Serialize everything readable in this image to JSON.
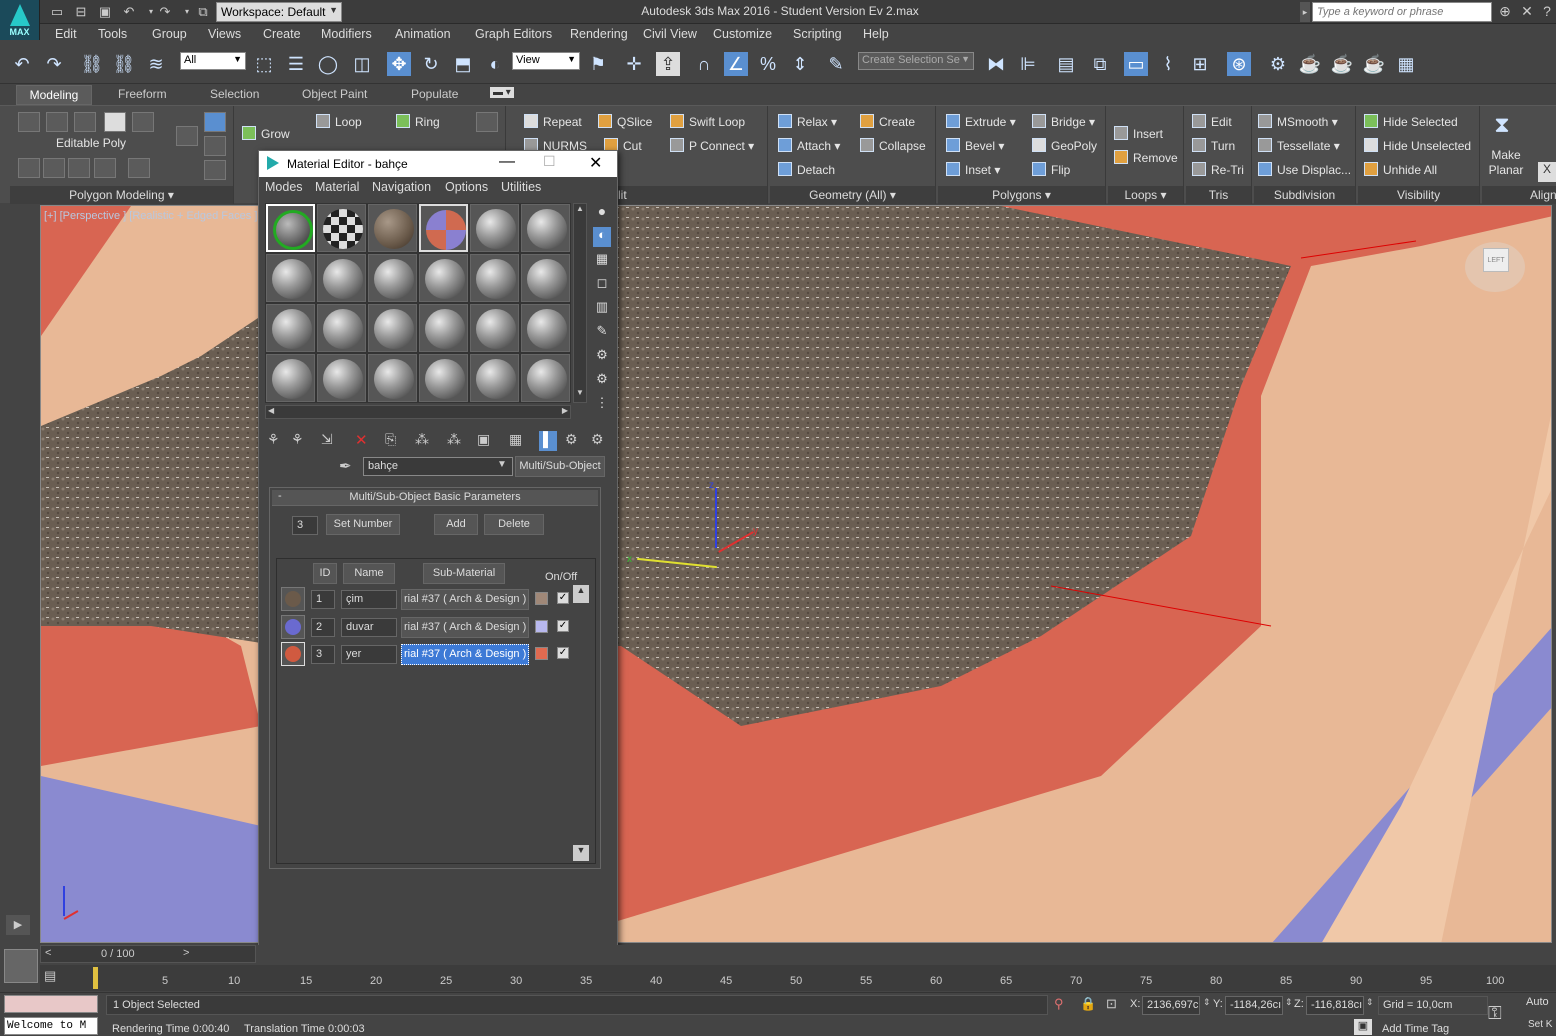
{
  "app": {
    "logo_text": "MAX",
    "window_title": "Autodesk 3ds Max 2016 - Student Version    Ev 2.max",
    "workspace_label": "Workspace: Default",
    "search_placeholder": "Type a keyword or phrase"
  },
  "menu": [
    "Edit",
    "Tools",
    "Group",
    "Views",
    "Create",
    "Modifiers",
    "Animation",
    "Graph Editors",
    "Rendering",
    "Civil View",
    "Customize",
    "Scripting",
    "Help"
  ],
  "toolbar": {
    "selection_filter": "All",
    "ref_coord": "View",
    "named_selection_placeholder": "Create Selection Se"
  },
  "ribbon_tabs": [
    "Modeling",
    "Freeform",
    "Selection",
    "Object Paint",
    "Populate"
  ],
  "ribbon": {
    "polygon_modeling": {
      "object_label": "Editable Poly",
      "footer": "Polygon Modeling"
    },
    "modify_selection": {
      "grow": "Grow",
      "loop": "Loop",
      "ring": "Ring"
    },
    "edit": {
      "repeat": "Repeat",
      "qslice": "QSlice",
      "swift_loop": "Swift Loop",
      "nurms": "NURMS",
      "cut": "Cut",
      "p_connect": "P Connect",
      "footer_fragment": "lit"
    },
    "geometry": {
      "relax": "Relax",
      "create": "Create",
      "attach": "Attach",
      "collapse": "Collapse",
      "detach": "Detach",
      "footer": "Geometry (All)"
    },
    "polygons": {
      "extrude": "Extrude",
      "bridge": "Bridge",
      "bevel": "Bevel",
      "geopoly": "GeoPoly",
      "inset": "Inset",
      "flip": "Flip",
      "footer": "Polygons"
    },
    "loops": {
      "insert": "Insert",
      "remove": "Remove",
      "footer": "Loops"
    },
    "tris": {
      "edit": "Edit",
      "turn": "Turn",
      "retri": "Re-Tri",
      "footer": "Tris"
    },
    "subdivision": {
      "msmooth": "MSmooth",
      "tessellate": "Tessellate",
      "use_displace": "Use Displac...",
      "footer": "Subdivision"
    },
    "visibility": {
      "hide_selected": "Hide Selected",
      "hide_unselected": "Hide Unselected",
      "unhide_all": "Unhide All",
      "footer": "Visibility"
    },
    "align": {
      "make_planar": "Make Planar",
      "footer": "Align",
      "x_label": "X"
    }
  },
  "viewport": {
    "label": "[+] [Perspective ] [Realistic + Edged Faces ]",
    "viewcube_label": "LEFT",
    "axis_labels": {
      "x": "x",
      "y": "y",
      "z": "z"
    }
  },
  "material_editor": {
    "title": "Material Editor - bahçe",
    "menu": [
      "Modes",
      "Material",
      "Navigation",
      "Options",
      "Utilities"
    ],
    "material_name": "bahçe",
    "material_type": "Multi/Sub-Object",
    "rollout_title": "Multi/Sub-Object Basic Parameters",
    "rollout_toggle": "-",
    "num_materials": "3",
    "set_number": "Set Number",
    "add": "Add",
    "delete": "Delete",
    "headers": {
      "id": "ID",
      "name": "Name",
      "sub_material": "Sub-Material",
      "onoff": "On/Off"
    },
    "rows": [
      {
        "id": "1",
        "name": "çim",
        "sub": "rial #37  ( Arch & Design )",
        "color": "#a08878",
        "ball": "#6b5a4a"
      },
      {
        "id": "2",
        "name": "duvar",
        "sub": "rial #37  ( Arch & Design )",
        "color": "#b8b8ee",
        "ball": "#6a6ad0"
      },
      {
        "id": "3",
        "name": "yer",
        "sub": "rial #37  ( Arch & Design )",
        "color": "#e06a50",
        "ball": "#d05a40"
      }
    ]
  },
  "timeline": {
    "frame": "0 / 100",
    "ticks": [
      "5",
      "10",
      "15",
      "20",
      "25",
      "30",
      "35",
      "40",
      "45",
      "50",
      "55",
      "60",
      "65",
      "70",
      "75",
      "80",
      "85",
      "90",
      "95",
      "100"
    ]
  },
  "status": {
    "maxscript": "Welcome to M",
    "selected": "1 Object Selected",
    "render_time": "Rendering Time  0:00:40",
    "translation_time": "Translation Time  0:00:03",
    "x_label": "X:",
    "x": "2136,697c",
    "y_label": "Y:",
    "y": "-1184,26cı",
    "z_label": "Z:",
    "z": "-116,818cı",
    "grid": "Grid = 10,0cm",
    "add_time_tag": "Add Time Tag",
    "auto_key": "Auto",
    "set_key": "Set K"
  }
}
